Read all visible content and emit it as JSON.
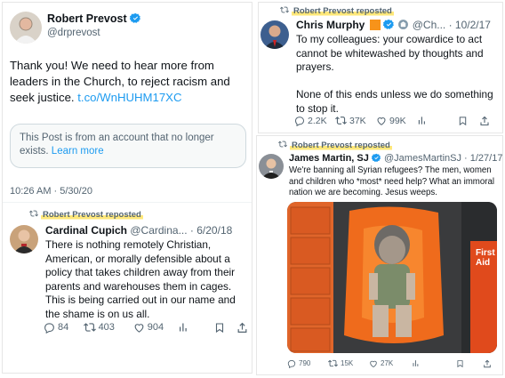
{
  "left": {
    "author_name": "Robert Prevost",
    "author_handle": "@drprevost",
    "text_line1": "Thank you! We need to hear more from",
    "text_line2": "leaders in the Church, to reject racism and",
    "text_line3": "seek justice.",
    "link": "t.co/WnHUHM17XC",
    "notice_line1": "This Post is from an account that no longer",
    "notice_line2": "exists.",
    "notice_learn_more": "Learn more",
    "timestamp": "10:26 AM · 5/30/20",
    "repost_label": "Robert Prevost reposted",
    "embedded": {
      "author_name": "Cardinal Cupich",
      "author_handle": "@Cardina...",
      "date": "· 6/20/18",
      "lines": [
        "There is nothing remotely Christian,",
        "American, or morally defensible about a",
        "policy that takes children away from their",
        "parents and warehouses them in cages.",
        "This is being carried out in our name and",
        "the shame is on us all."
      ],
      "replies": "84",
      "reposts": "403",
      "likes": "904"
    }
  },
  "right_top": {
    "repost_label": "Robert Prevost reposted",
    "author_name": "Chris Murphy",
    "author_handle": "@Ch...",
    "date": "· 10/2/17",
    "lines": [
      "To my colleagues: your cowardice to act",
      "cannot be whitewashed by thoughts and",
      "prayers.",
      "",
      "None of this ends unless we do something",
      "to stop it."
    ],
    "replies": "2.2K",
    "reposts": "37K",
    "likes": "99K"
  },
  "right_bottom": {
    "repost_label": "Robert Prevost reposted",
    "author_name": "James Martin, SJ",
    "author_handle": "@JamesMartinSJ",
    "date": "· 1/27/17",
    "lines": [
      "We're banning all Syrian refugees? The men, women",
      "and children who *most* need help? What an immoral",
      "nation we are becoming. Jesus weeps."
    ],
    "image_side_text": "First Aid",
    "replies": "790",
    "reposts": "15K",
    "likes": "27K"
  },
  "colors": {
    "accent_blue": "#1d9bf0",
    "muted": "#536471",
    "highlight": "#ffe87a",
    "orange_badge": "#f7931a"
  }
}
